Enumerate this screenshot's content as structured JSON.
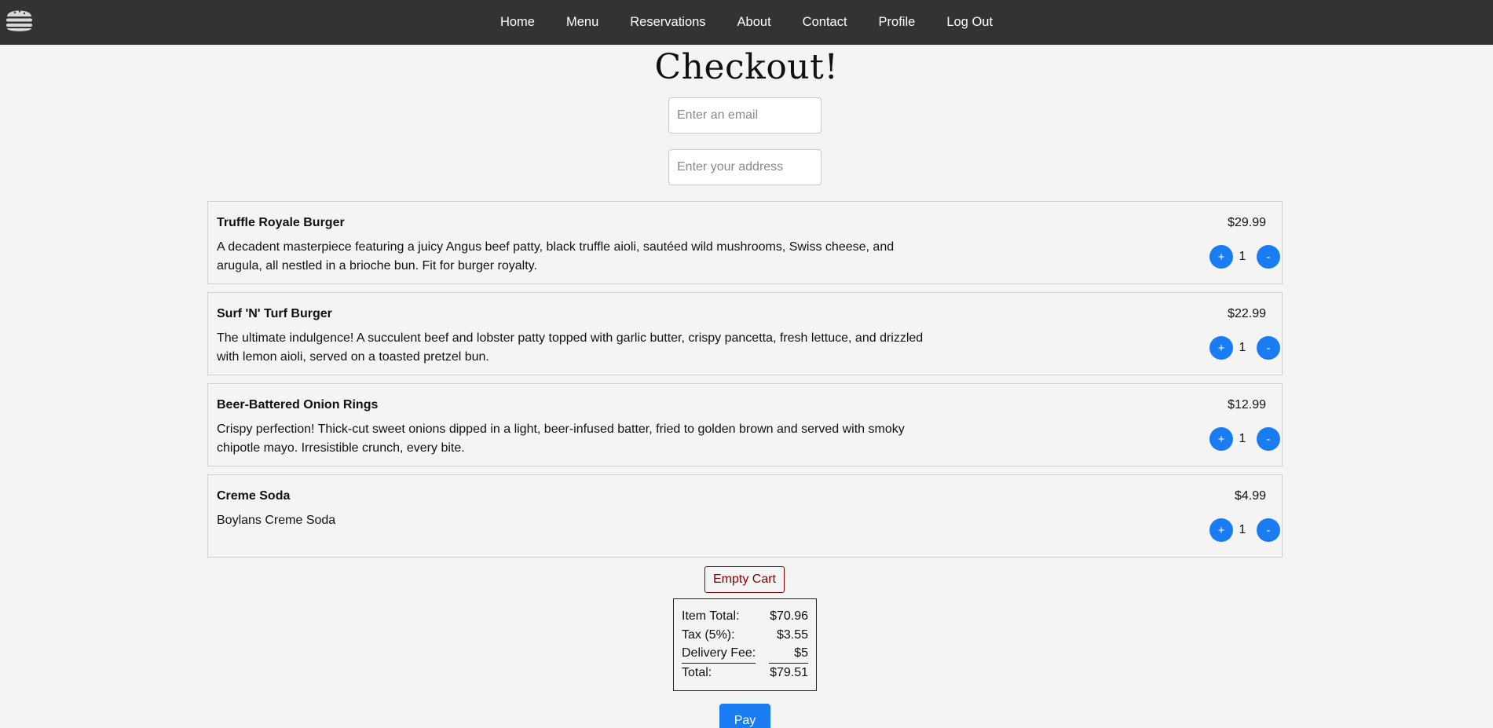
{
  "nav": {
    "logo_icon": "burger-icon",
    "links": [
      "Home",
      "Menu",
      "Reservations",
      "About",
      "Contact",
      "Profile",
      "Log Out"
    ]
  },
  "page": {
    "title": "Checkout!"
  },
  "form": {
    "email_placeholder": "Enter an email",
    "address_placeholder": "Enter your address"
  },
  "cart": {
    "items": [
      {
        "name": "Truffle Royale Burger",
        "description": "A decadent masterpiece featuring a juicy Angus beef patty, black truffle aioli, sautéed wild mushrooms, Swiss cheese, and arugula, all nestled in a brioche bun. Fit for burger royalty.",
        "price": "$29.99",
        "quantity": "1"
      },
      {
        "name": "Surf 'N' Turf Burger",
        "description": "The ultimate indulgence! A succulent beef and lobster patty topped with garlic butter, crispy pancetta, fresh lettuce, and drizzled with lemon aioli, served on a toasted pretzel bun.",
        "price": "$22.99",
        "quantity": "1"
      },
      {
        "name": "Beer-Battered Onion Rings",
        "description": "Crispy perfection! Thick-cut sweet onions dipped in a light, beer-infused batter, fried to golden brown and served with smoky chipotle mayo. Irresistible crunch, every bite.",
        "price": "$12.99",
        "quantity": "1"
      },
      {
        "name": "Creme Soda",
        "description": "Boylans Creme Soda",
        "price": "$4.99",
        "quantity": "1"
      }
    ],
    "plus_label": "+",
    "minus_label": "-",
    "empty_label": "Empty Cart"
  },
  "summary": {
    "item_total_label": "Item Total:",
    "item_total": "$70.96",
    "tax_label": "Tax (5%):",
    "tax": "$3.55",
    "fee_label": "Delivery Fee:",
    "fee": "$5",
    "total_label": "Total:",
    "total": "$79.51"
  },
  "pay_label": "Pay",
  "colors": {
    "navbar": "#333333",
    "accent": "#1a7cf2",
    "danger": "#8b0000",
    "background": "#f4f4f4"
  }
}
